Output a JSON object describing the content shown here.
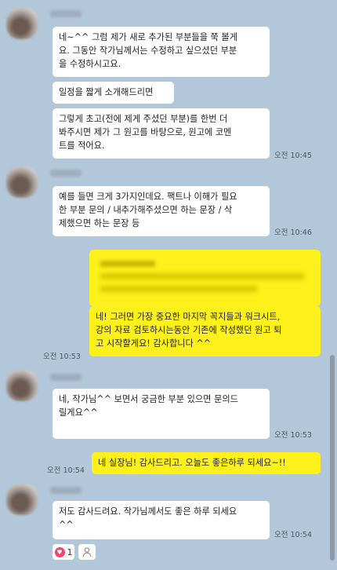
{
  "messages": {
    "m1": "네~^^ 그럼 제가 새로 추가된 부분들을 쭉 볼게\n요. 그동안 작가님께서는 수정하고 싶으셨던 부분\n을 수정하시고요.",
    "m2": "일정을 짧게 소개해드리면",
    "m3": "그렇게 초고(전에 제게 주셨던 부분)를 한번 더\n봐주시면 제가 그 원고를 바탕으로, 원고에 코멘\n트를 적어요.",
    "m4": "예를 들면 크게 3가지인데요. 팩트나 이해가 필요\n한 부분 문의 / 내추가해주셨으면 하는 문장 / 삭\n제했으면 하는 문장 등",
    "m5": "네! 그러면 가장 중요한 마지막 꼭지들과 워크시트,\n강의 자료 검토하시는동안 기존에 작성했던 원고 퇴\n고 시작할게요! 감사합니다 ^^",
    "m6": "네, 작가님^^ 보면서 궁금한 부분 있으면 문의드\n릴게요^^",
    "m7": "네 실장님! 감사드리고. 오늘도 좋은하루 되세요~!!",
    "m8": "저도 감사드려요. 작가님께서도 좋은 하루 되세요\n^^"
  },
  "times": {
    "t1": "오전 10:45",
    "t2": "오전 10:46",
    "t3": "오전 10:53",
    "t4": "오전 10:53",
    "t5": "오전 10:54",
    "t6": "오전 10:54"
  },
  "reactions": {
    "heart_count": "1"
  },
  "colors": {
    "background": "#b2c7d9",
    "my_bubble": "#fef01b",
    "their_bubble": "#ffffff",
    "heart": "#f1466b"
  },
  "icons": {
    "heart": "heart-icon",
    "reaction_add": "person-icon"
  }
}
